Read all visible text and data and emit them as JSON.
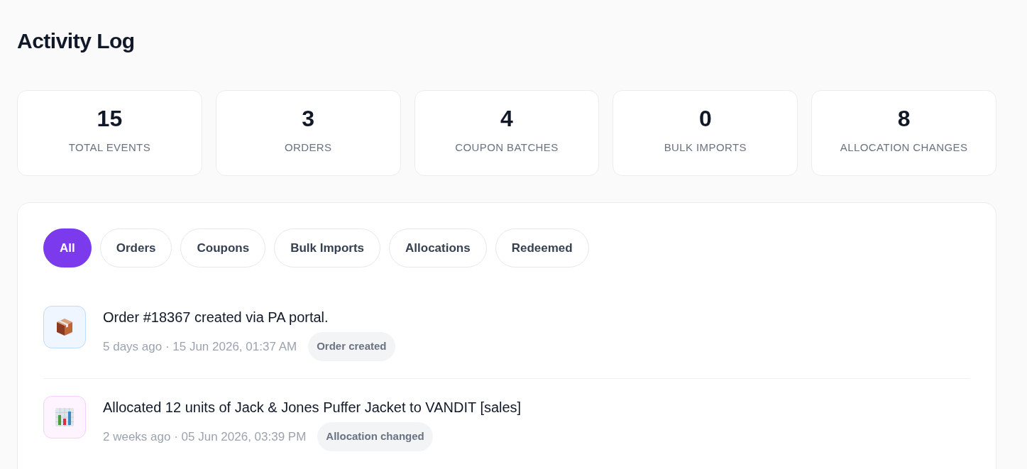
{
  "page": {
    "title": "Activity Log"
  },
  "stats": [
    {
      "value": "15",
      "label": "TOTAL EVENTS"
    },
    {
      "value": "3",
      "label": "ORDERS"
    },
    {
      "value": "4",
      "label": "COUPON BATCHES"
    },
    {
      "value": "0",
      "label": "BULK IMPORTS"
    },
    {
      "value": "8",
      "label": "ALLOCATION CHANGES"
    }
  ],
  "filters": [
    {
      "label": "All",
      "selected": true
    },
    {
      "label": "Orders",
      "selected": false
    },
    {
      "label": "Coupons",
      "selected": false
    },
    {
      "label": "Bulk Imports",
      "selected": false
    },
    {
      "label": "Allocations",
      "selected": false
    },
    {
      "label": "Redeemed",
      "selected": false
    }
  ],
  "events": [
    {
      "kind": "order",
      "text": "Order #18367 created via PA portal.",
      "time": "5 days ago · 15 Jun 2026, 01:37 AM",
      "badge": "Order created"
    },
    {
      "kind": "allocation",
      "text": "Allocated 12 units of Jack & Jones Puffer Jacket to VANDIT [sales]",
      "time": "2 weeks ago · 05 Jun 2026, 03:39 PM",
      "badge": "Allocation changed"
    }
  ]
}
